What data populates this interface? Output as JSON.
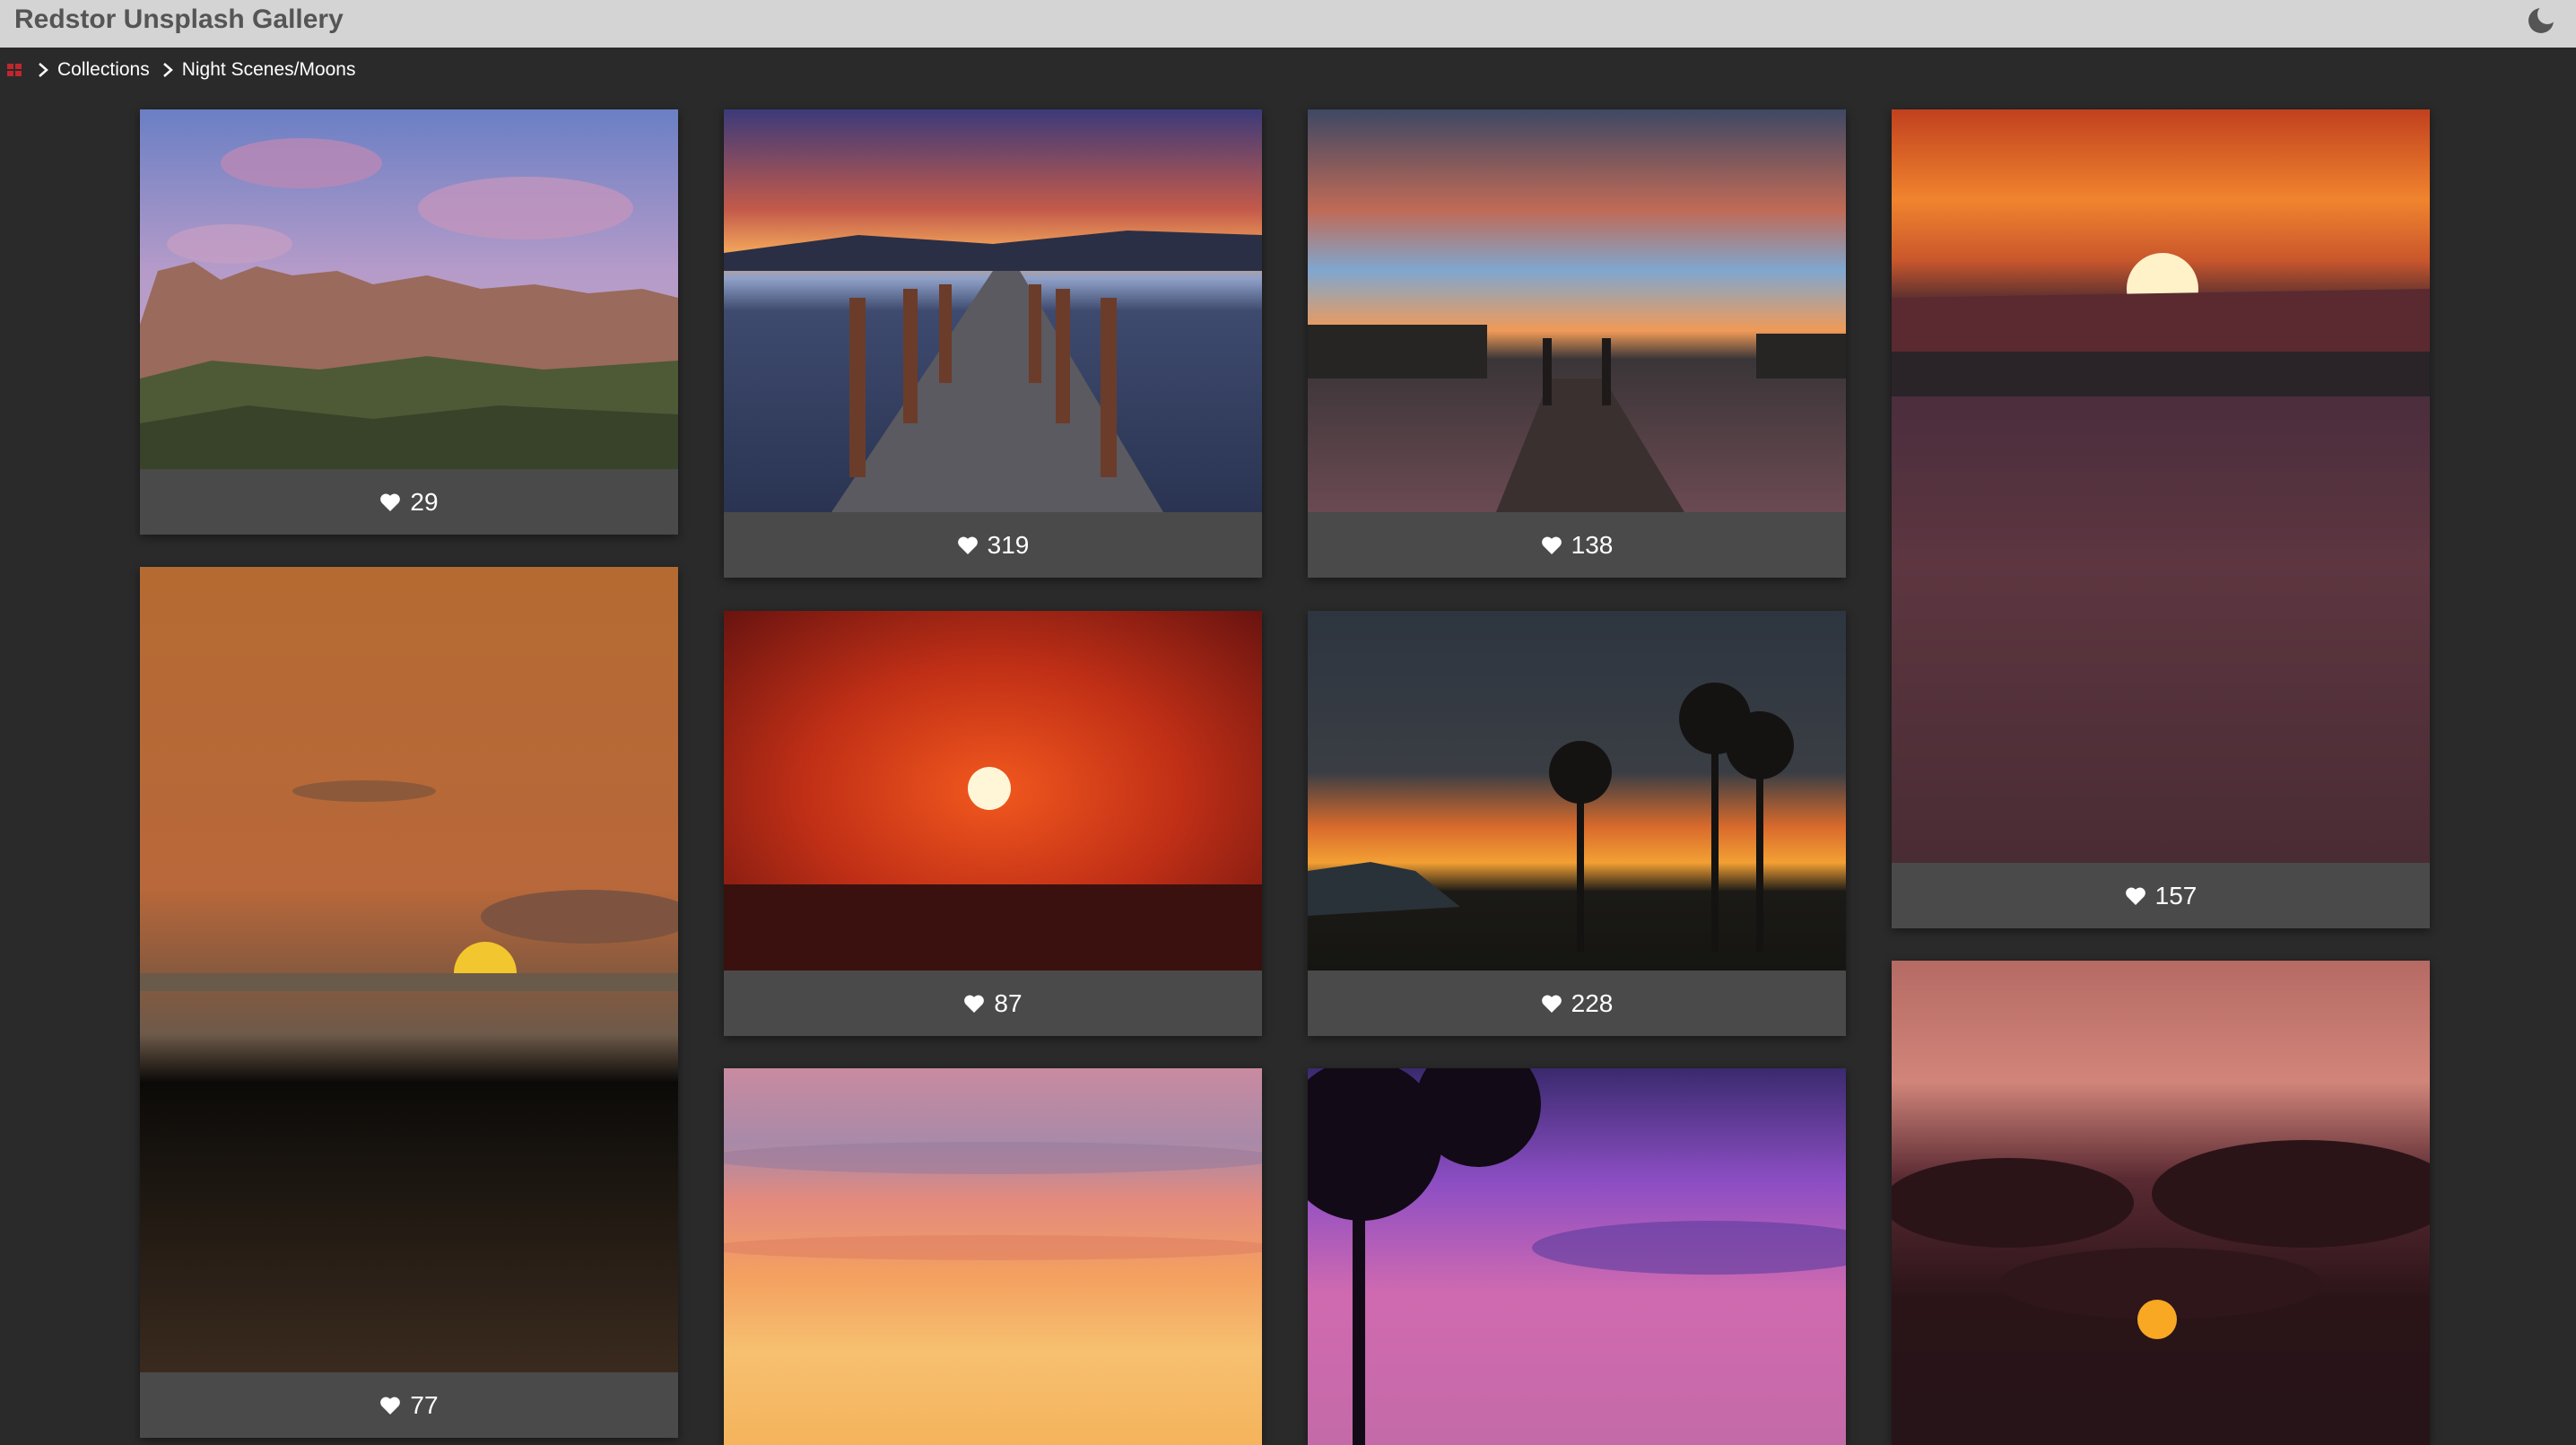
{
  "app": {
    "title": "Redstor Unsplash Gallery"
  },
  "breadcrumb": [
    {
      "label": "Collections"
    },
    {
      "label": "Night Scenes/Moons"
    }
  ],
  "photos": [
    {
      "likes": "29"
    },
    {
      "likes": "319"
    },
    {
      "likes": "138"
    },
    {
      "likes": "157"
    },
    {
      "likes": "77"
    },
    {
      "likes": "87"
    },
    {
      "likes": "228"
    },
    {
      "likes": ""
    },
    {
      "likes": ""
    },
    {
      "likes": ""
    }
  ],
  "icons": {
    "theme": "moon-icon",
    "home": "home-icon",
    "separator": "chevron-right-icon",
    "like": "heart-icon"
  },
  "colors": {
    "topbar": "#d4d4d4",
    "background": "#2a2a2a",
    "card_footer": "#4a4a4a",
    "home_icon": "#c0272d"
  }
}
